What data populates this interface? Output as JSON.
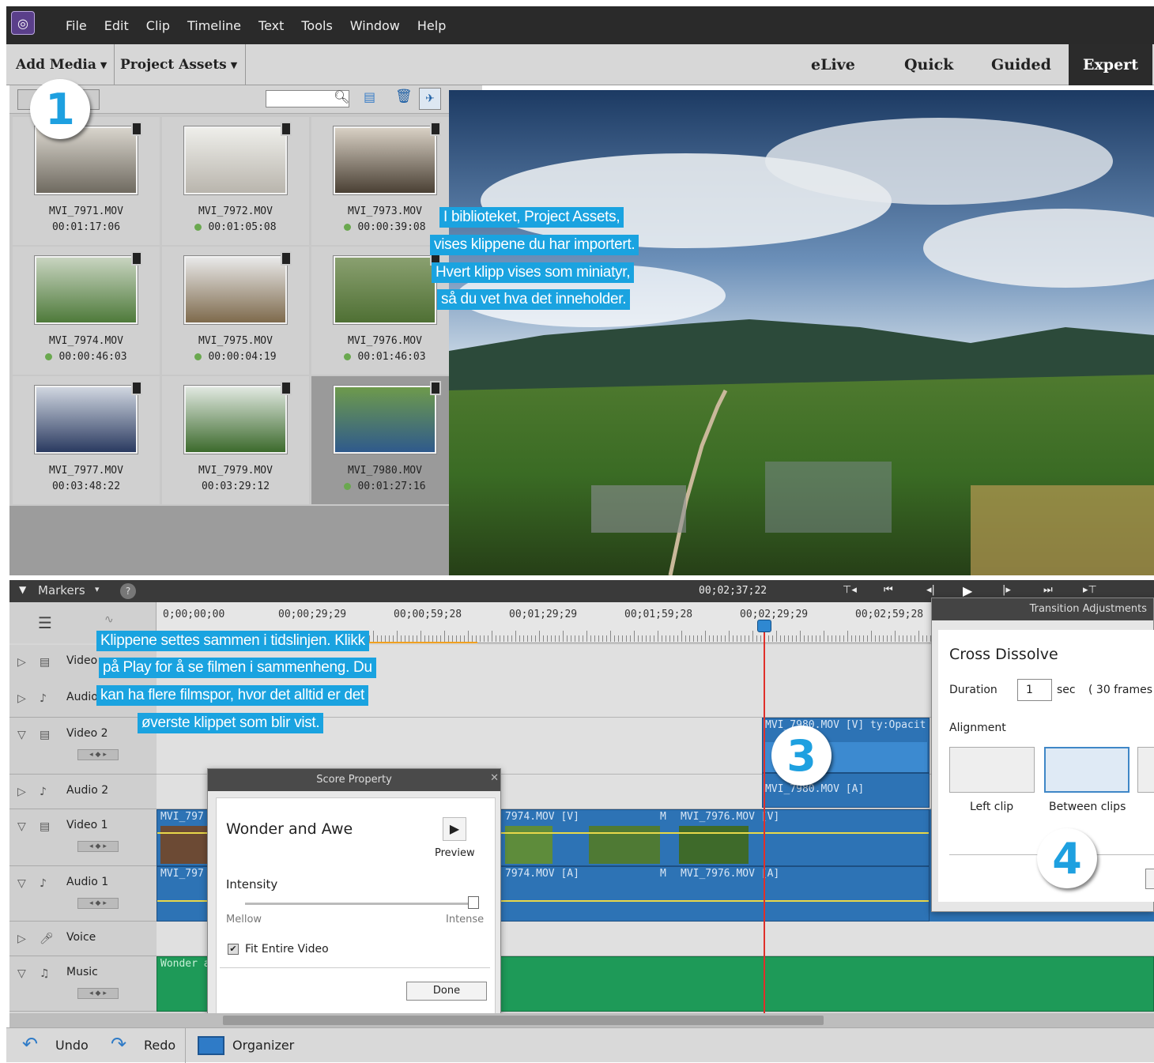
{
  "menu": {
    "items": [
      "File",
      "Edit",
      "Clip",
      "Timeline",
      "Text",
      "Tools",
      "Window",
      "Help"
    ]
  },
  "modebar": {
    "add_media": "Add Media",
    "project_assets": "Project Assets",
    "modes": [
      "eLive",
      "Quick",
      "Guided",
      "Expert"
    ]
  },
  "assets": [
    {
      "name": "MVI_7971.MOV",
      "time": "00:01:17:06",
      "used": false
    },
    {
      "name": "MVI_7972.MOV",
      "time": "00:01:05:08",
      "used": true
    },
    {
      "name": "MVI_7973.MOV",
      "time": "00:00:39:08",
      "used": true
    },
    {
      "name": "MVI_7974.MOV",
      "time": "00:00:46:03",
      "used": true
    },
    {
      "name": "MVI_7975.MOV",
      "time": "00:00:04:19",
      "used": true
    },
    {
      "name": "MVI_7976.MOV",
      "time": "00:01:46:03",
      "used": true
    },
    {
      "name": "MVI_7977.MOV",
      "time": "00:03:48:22",
      "used": false
    },
    {
      "name": "MVI_7979.MOV",
      "time": "00:03:29:12",
      "used": false
    },
    {
      "name": "MVI_7980.MOV",
      "time": "00:01:27:16",
      "used": true
    }
  ],
  "annotations": {
    "a1": [
      "I biblioteket, Project Assets,",
      "vises klippene du har importert.",
      "Hvert klipp vises som miniatyr,",
      "så du vet hva det inneholder."
    ],
    "a2": [
      "Klippene settes sammen i tidslinjen. Klikk",
      "på Play for å se filmen i sammenheng. Du",
      "kan ha flere filmspor, hvor det alltid er det",
      "øverste klippet som blir vist."
    ],
    "badge1": "1",
    "badge3": "3",
    "badge4": "4"
  },
  "timeline": {
    "markers": "Markers",
    "timecode": "00;02;37;22",
    "ruler": [
      "0;00;00;00",
      "00;00;29;29",
      "00;00;59;28",
      "00;01;29;29",
      "00;01;59;28",
      "00;02;29;29",
      "00;02;59;28"
    ],
    "tracks": [
      "Video",
      "Audio",
      "Video 2",
      "Audio 2",
      "Video 1",
      "Audio 1",
      "Voice",
      "Music"
    ],
    "clips": {
      "v2a": "MVI_7980.MOV [V] ty:Opacit",
      "a2a": "MVI_7980.MOV [A]",
      "v1a": "MVI_797",
      "v1b": "7974.MOV [V]",
      "v1c": "M",
      "v1d": "MVI_7976.MOV [V]",
      "a1a": "MVI_797",
      "a1b": "7974.MOV [A]",
      "a1c": "M",
      "a1d": "MVI_7976.MOV [A]",
      "music": "Wonder a"
    }
  },
  "score": {
    "title": "Score Property",
    "name": "Wonder and Awe",
    "preview": "Preview",
    "intensity": "Intensity",
    "mellow": "Mellow",
    "intense": "Intense",
    "fit": "Fit Entire Video",
    "done": "Done"
  },
  "transition": {
    "title": "Transition Adjustments",
    "name": "Cross Dissolve",
    "duration_label": "Duration",
    "duration_value": "1",
    "sec": "sec",
    "frames": "( 30 frames",
    "alignment": "Alignment",
    "left": "Left clip",
    "between": "Between clips"
  },
  "bottom": {
    "undo": "Undo",
    "redo": "Redo",
    "organizer": "Organizer"
  }
}
